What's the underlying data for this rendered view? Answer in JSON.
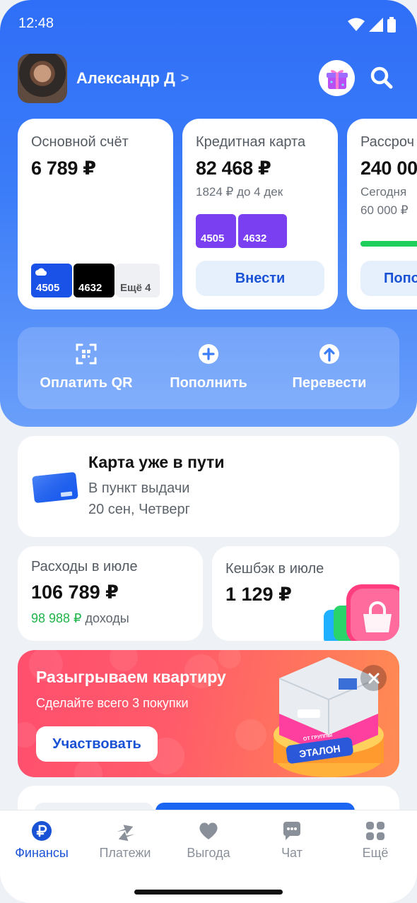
{
  "status_bar": {
    "time": "12:48"
  },
  "profile": {
    "name": "Александр Д",
    "chevron": ">"
  },
  "accounts": [
    {
      "title": "Основной счёт",
      "amount": "6 789 ₽",
      "cards": [
        "4505",
        "4632"
      ],
      "more_label": "Ещё 4"
    },
    {
      "title": "Кредитная карта",
      "amount": "82 468 ₽",
      "sub": "1824 ₽ до 4 дек",
      "cards": [
        "4505",
        "4632"
      ],
      "action": "Внести"
    },
    {
      "title": "Рассроч",
      "amount": "240 00",
      "sub1": "Сегодня",
      "sub2": "60 000 ₽",
      "action": "Попо",
      "progress": 0.9
    }
  ],
  "quick_actions": [
    {
      "label": "Оплатить QR",
      "icon": "qr-scan-icon"
    },
    {
      "label": "Пополнить",
      "icon": "plus-circle-icon"
    },
    {
      "label": "Перевести",
      "icon": "arrow-up-circle-icon"
    }
  ],
  "delivery": {
    "title": "Карта уже в пути",
    "line1": "В пункт выдачи",
    "line2": "20 сен, Четверг"
  },
  "expenses": {
    "title": "Расходы в июле",
    "amount": "106 789 ₽",
    "income_value": "98 988 ₽",
    "income_label": " доходы"
  },
  "cashback": {
    "title": "Кешбэк в июле",
    "amount": "1 129 ₽"
  },
  "promo": {
    "title": "Разыгрываем квартиру",
    "subtitle": "Сделайте всего 3 покупки",
    "button": "Участвовать",
    "logo_text": "ЭТАЛОН",
    "logo_small": "ОТ ГРУППЫ"
  },
  "tabs": [
    {
      "label": "Финансы",
      "icon": "ruble-icon",
      "active": true
    },
    {
      "label": "Платежи",
      "icon": "transfer-arrows-icon",
      "active": false
    },
    {
      "label": "Выгода",
      "icon": "heart-icon",
      "active": false
    },
    {
      "label": "Чат",
      "icon": "chat-icon",
      "active": false
    },
    {
      "label": "Ещё",
      "icon": "grid-icon",
      "active": false
    }
  ],
  "colors": {
    "brand_blue": "#2f6ef7",
    "action_blue": "#1a52d6",
    "card_purple": "#7a3ff0",
    "income_green": "#1fb449",
    "promo_red": "#ff4f6e",
    "progress_green": "#1fcf5b"
  }
}
